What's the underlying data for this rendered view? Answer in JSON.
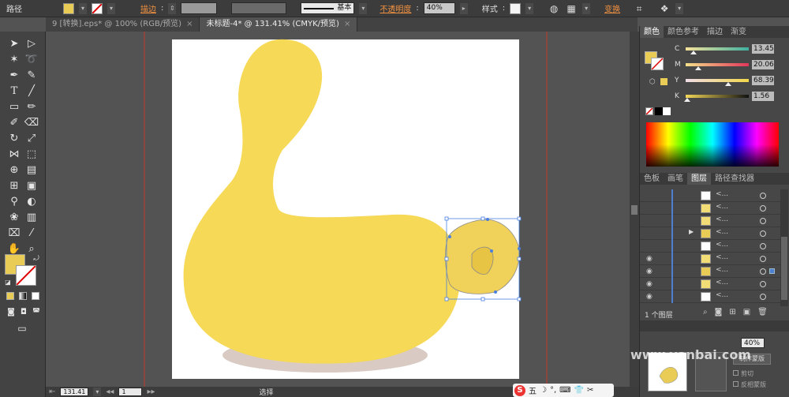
{
  "control_bar": {
    "object_label": "路径",
    "stroke_label": "描边",
    "stroke_profile": "基本",
    "opacity_label": "不透明度",
    "opacity_value": "40%",
    "style_label": "样式",
    "transform_label": "变换",
    "fill_color": "#e8cc56"
  },
  "tabs": [
    {
      "label": "9 [转换].eps* @ 100% (RGB/预览)",
      "close": "×"
    },
    {
      "label": "未标题-4* @ 131.41% (CMYK/预览)",
      "close": "×"
    }
  ],
  "status": {
    "zoom": "131.41",
    "page": "1",
    "tool": "选择"
  },
  "color_panel": {
    "tabs": [
      "颜色",
      "颜色参考",
      "描边",
      "渐变"
    ],
    "channels": [
      {
        "label": "C",
        "value": "13.45",
        "fraction": 0.13
      },
      {
        "label": "M",
        "value": "20.06",
        "fraction": 0.2
      },
      {
        "label": "Y",
        "value": "68.39",
        "fraction": 0.68
      },
      {
        "label": "K",
        "value": "1.56",
        "fraction": 0.02
      }
    ]
  },
  "layers_panel": {
    "tabs": [
      "色板",
      "画笔",
      "图层",
      "路径查找器"
    ],
    "rows": [
      {
        "name": "<...",
        "eye": "",
        "thumb": "#ffffff"
      },
      {
        "name": "<...",
        "eye": "",
        "thumb": "#f2dc76"
      },
      {
        "name": "<...",
        "eye": "",
        "thumb": "#f2dc76"
      },
      {
        "name": "<...",
        "eye": "",
        "thumb": "#e8cc56",
        "expand": "▶"
      },
      {
        "name": "<...",
        "eye": "",
        "thumb": "#ffffff"
      },
      {
        "name": "<...",
        "eye": "◉",
        "thumb": "#f2dc76"
      },
      {
        "name": "<...",
        "eye": "◉",
        "thumb": "#e8cc56",
        "selected": true
      },
      {
        "name": "<...",
        "eye": "◉",
        "thumb": "#f2dc76"
      },
      {
        "name": "<...",
        "eye": "◉",
        "thumb": "#ffffff"
      }
    ],
    "footer": "1 个图层"
  },
  "transparency_panel": {
    "opacity_value": "40%",
    "make_mask": "制作蒙版",
    "clip_label": "剪切",
    "invert_mask": "反相蒙版"
  },
  "taskbar": {
    "ime_label": "五"
  },
  "watermark": "www.yanbai.com"
}
